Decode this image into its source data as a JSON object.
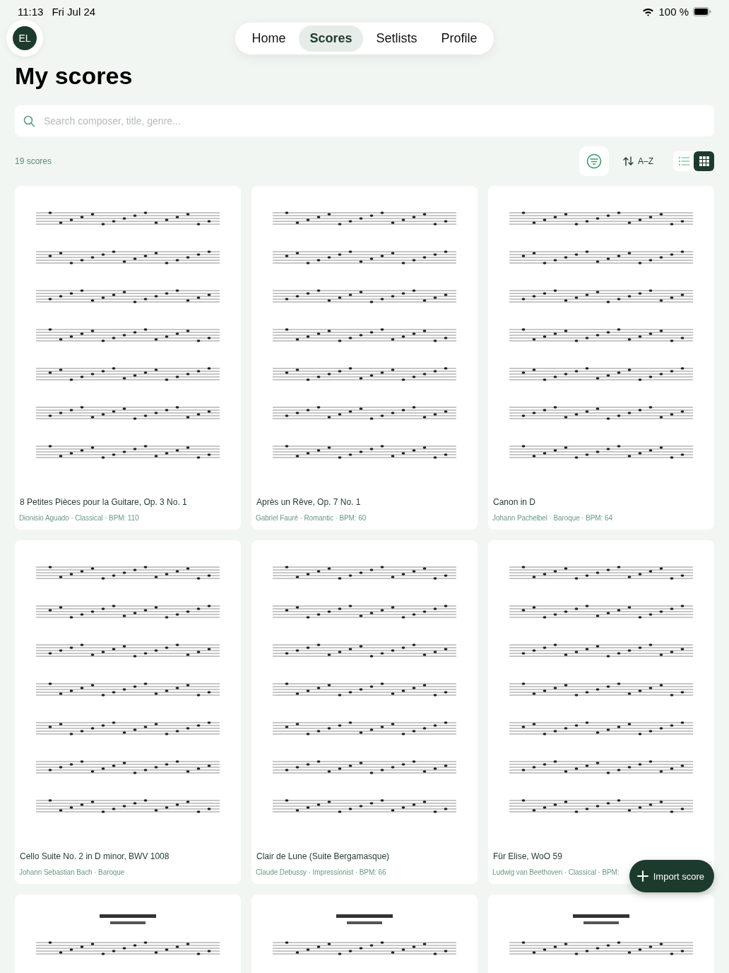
{
  "status_bar": {
    "time": "11:13",
    "date": "Fri Jul 24",
    "battery": "100 %"
  },
  "avatar": {
    "initials": "EL"
  },
  "tabs": [
    {
      "label": "Home",
      "selected": false
    },
    {
      "label": "Scores",
      "selected": true
    },
    {
      "label": "Setlists",
      "selected": false
    },
    {
      "label": "Profile",
      "selected": false
    }
  ],
  "title": "My scores",
  "search": {
    "placeholder": "Search composer, title, genre..."
  },
  "toolbar": {
    "count": "19 scores",
    "sort": "A–Z",
    "view_modes": [
      {
        "kind": "list",
        "selected": false
      },
      {
        "kind": "grid",
        "selected": true
      }
    ]
  },
  "scores": [
    {
      "title": "8 Petites Pièces pour la Guitare, Op. 3 No. 1",
      "meta": "Dionisio Aguado · Classical · BPM: 110"
    },
    {
      "title": "Après un Rêve, Op. 7 No. 1",
      "meta": "Gabriel Fauré · Romantic · BPM: 60"
    },
    {
      "title": "Canon in D",
      "meta": "Johann Pachelbel · Baroque · BPM: 64"
    },
    {
      "title": "Cello Suite No. 2 in D minor, BWV 1008",
      "meta": "Johann Sebastian Bach · Baroque"
    },
    {
      "title": "Clair de Lune (Suite Bergamasque)",
      "meta": "Claude Debussy · Impressionist · BPM: 66"
    },
    {
      "title": "Für Elise, WoO 59",
      "meta": "Ludwig van Beethoven · Classical · BPM:"
    },
    {
      "kind": "cut"
    },
    {
      "kind": "cut"
    },
    {
      "kind": "cut"
    }
  ],
  "import_button": {
    "label": "Import score"
  }
}
